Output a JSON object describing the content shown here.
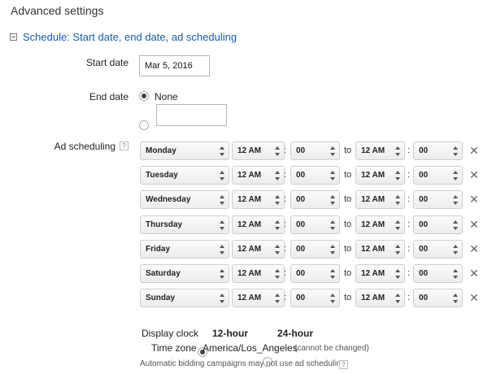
{
  "header": {
    "title": "Advanced settings"
  },
  "schedule_section": {
    "title": "Schedule: Start date, end date, ad scheduling"
  },
  "start_date": {
    "label": "Start date",
    "value": "Mar 5, 2016"
  },
  "end_date": {
    "label": "End date",
    "none_label": "None",
    "custom_value": "",
    "selected": "none"
  },
  "ad_scheduling": {
    "label": "Ad scheduling",
    "help": "?",
    "to_label": "to",
    "colon": ":",
    "rows": [
      {
        "day": "Monday",
        "from_hour": "12 AM",
        "from_min": "00",
        "to_hour": "12 AM",
        "to_min": "00"
      },
      {
        "day": "Tuesday",
        "from_hour": "12 AM",
        "from_min": "00",
        "to_hour": "12 AM",
        "to_min": "00"
      },
      {
        "day": "Wednesday",
        "from_hour": "12 AM",
        "from_min": "00",
        "to_hour": "12 AM",
        "to_min": "00"
      },
      {
        "day": "Thursday",
        "from_hour": "12 AM",
        "from_min": "00",
        "to_hour": "12 AM",
        "to_min": "00"
      },
      {
        "day": "Friday",
        "from_hour": "12 AM",
        "from_min": "00",
        "to_hour": "12 AM",
        "to_min": "00"
      },
      {
        "day": "Saturday",
        "from_hour": "12 AM",
        "from_min": "00",
        "to_hour": "12 AM",
        "to_min": "00"
      },
      {
        "day": "Sunday",
        "from_hour": "12 AM",
        "from_min": "00",
        "to_hour": "12 AM",
        "to_min": "00"
      }
    ],
    "remove_icon": "close-icon"
  },
  "display_clock": {
    "label": "Display clock",
    "option_12": "12-hour",
    "option_24": "24-hour",
    "selected": "12-hour"
  },
  "time_zone": {
    "label": "Time zone",
    "value": "America/Los_Angeles",
    "note": "(cannot be changed)"
  },
  "footer_note": {
    "text": "Automatic bidding campaigns may not use ad scheduling",
    "help": "?"
  },
  "colors": {
    "link_blue": "#1a5ba8"
  }
}
